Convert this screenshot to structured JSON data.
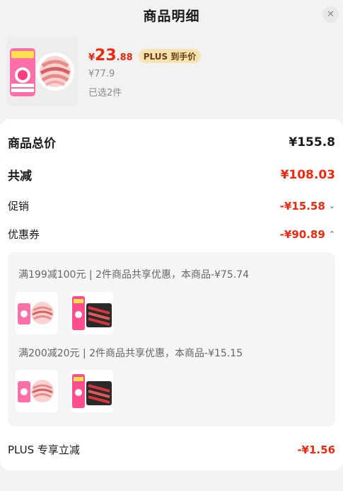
{
  "header": {
    "title": "商品明细",
    "close_icon": "close-icon"
  },
  "product": {
    "image": "product-meat-image",
    "price_symbol": "¥",
    "price_int": "23",
    "price_dec": ".88",
    "plus_tag": "PLUS 到手价",
    "original_price": "¥77.9",
    "selected_count": "已选2件"
  },
  "details": {
    "total": {
      "label": "商品总价",
      "value": "¥155.8"
    },
    "discount": {
      "label": "共减",
      "value": "¥108.03"
    },
    "promotion": {
      "label": "促销",
      "value": "-¥15.58",
      "chevron": "chevron-down-icon"
    },
    "coupon": {
      "label": "优惠券",
      "value": "-¥90.89",
      "chevron": "chevron-up-icon"
    },
    "coupon_details": [
      {
        "desc": "满199减100元 | 2件商品共享优惠，本商品-¥75.74",
        "items": [
          "lamb-roll-product",
          "beef-roll-product"
        ]
      },
      {
        "desc": "满200减20元 | 2件商品共享优惠，本商品-¥15.15",
        "items": [
          "lamb-roll-product",
          "beef-roll-product"
        ]
      }
    ],
    "plus": {
      "label": "PLUS 专享立减",
      "value": "-¥1.56"
    }
  },
  "colors": {
    "accent_red": "#f2270c",
    "plus_gold": "#f6e2b3",
    "plus_text": "#6b3f05"
  }
}
